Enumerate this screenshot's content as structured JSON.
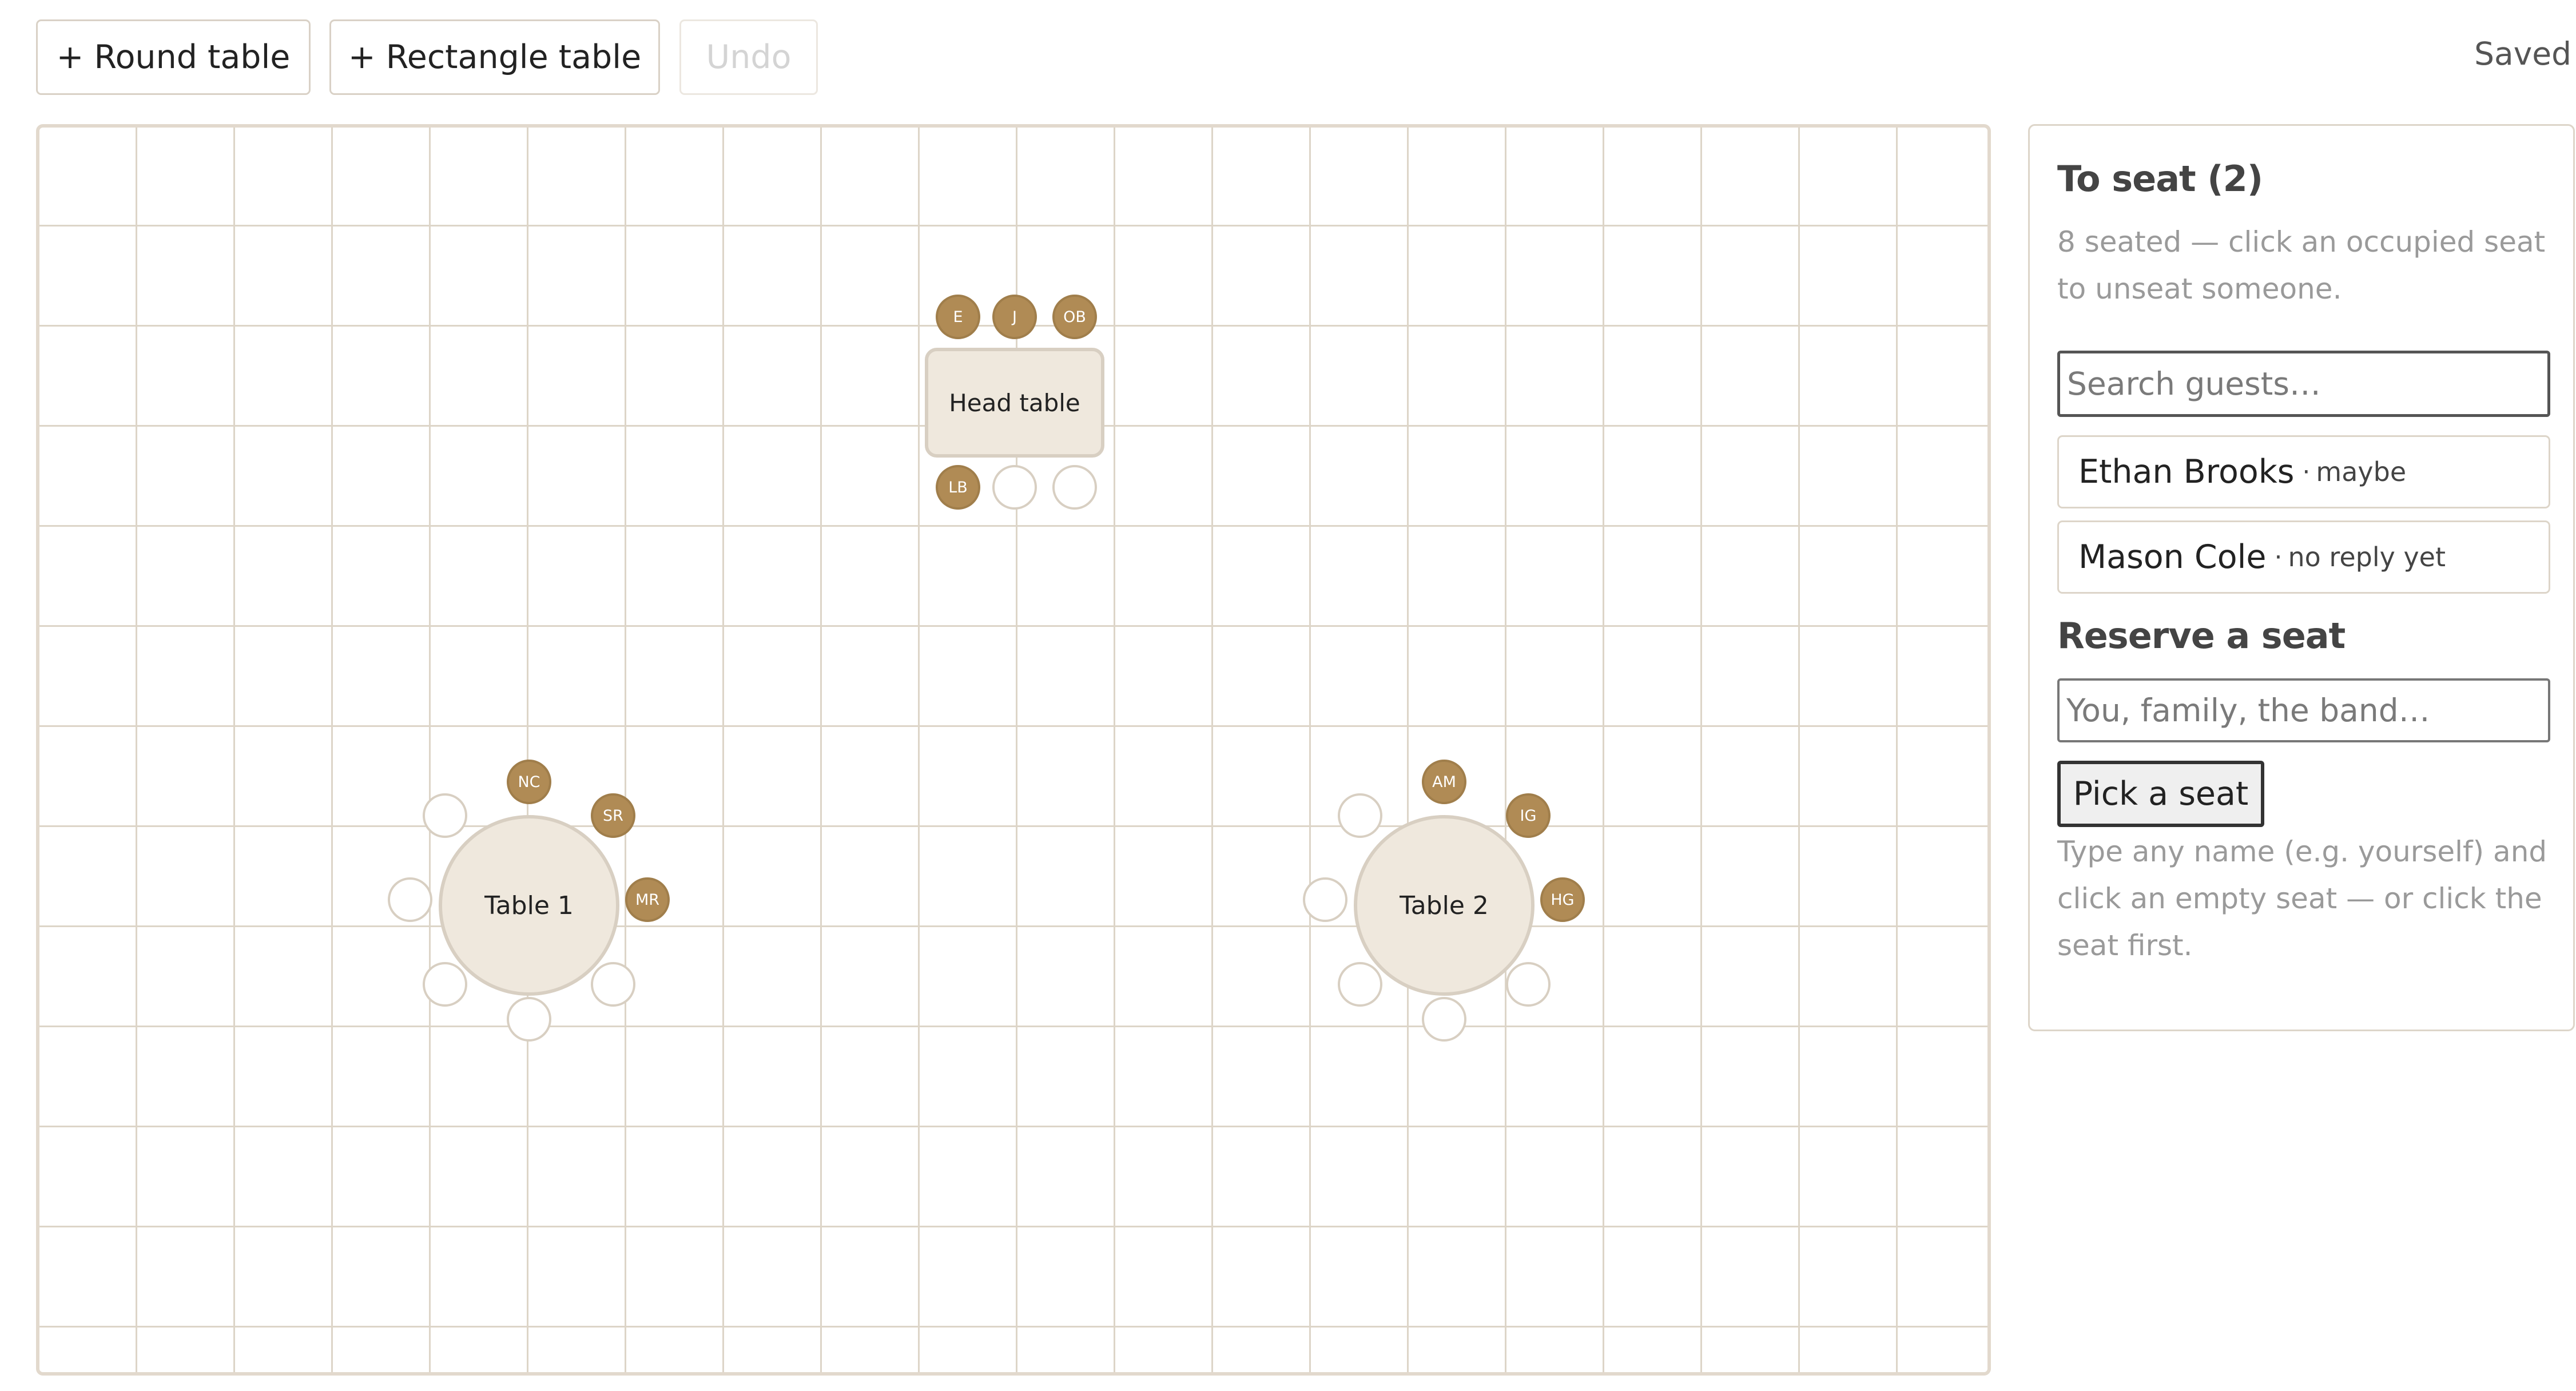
{
  "toolbar": {
    "round_table_label": "+ Round table",
    "rect_table_label": "+ Rectangle table",
    "undo_label": "Undo",
    "status": "Saved"
  },
  "floor": {
    "head_table": {
      "label": "Head table",
      "top_seats": [
        "E",
        "J",
        "OB"
      ],
      "bottom_seats": [
        "LB",
        "",
        ""
      ]
    },
    "table1": {
      "label": "Table 1",
      "seats": [
        "NC",
        "SR",
        "MR",
        "",
        "",
        "",
        "",
        ""
      ]
    },
    "table2": {
      "label": "Table 2",
      "seats": [
        "AM",
        "IG",
        "HG",
        "",
        "",
        "",
        "",
        ""
      ]
    }
  },
  "panel": {
    "to_seat_title": "To seat (2)",
    "to_seat_hint": "8 seated — click an occupied seat to unseat someone.",
    "search_placeholder": "Search guests…",
    "guests": [
      {
        "name": "Ethan Brooks",
        "status": "maybe"
      },
      {
        "name": "Mason Cole",
        "status": "no reply yet"
      }
    ],
    "reserve_title": "Reserve a seat",
    "reserve_placeholder": "You, family, the band…",
    "pick_label": "Pick a seat",
    "reserve_hint": "Type any name (e.g. yourself) and click an empty seat — or click the seat first."
  },
  "colors": {
    "accent": "#b08b55",
    "table_fill": "#efe8dd",
    "grid": "#ddd5c8"
  }
}
